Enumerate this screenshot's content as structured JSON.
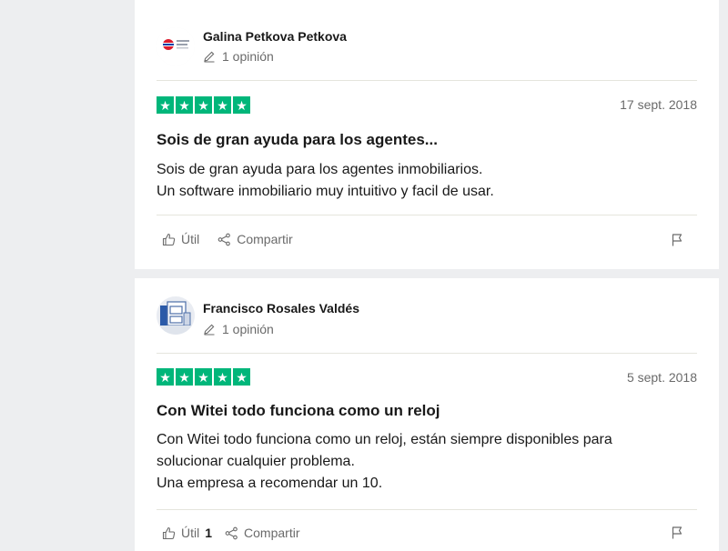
{
  "reviews": [
    {
      "author": "Galina Petkova Petkova",
      "reviews_count": "1 opinión",
      "rating": 5,
      "date": "17 sept. 2018",
      "title": "Sois de gran ayuda para los agentes...",
      "body": [
        "Sois de gran ayuda para los agentes inmobiliarios.",
        "Un software inmobiliario muy intuitivo y facil de usar."
      ],
      "useful_label": "Útil",
      "useful_count": "",
      "share_label": "Compartir"
    },
    {
      "author": "Francisco Rosales Valdés",
      "reviews_count": "1 opinión",
      "rating": 5,
      "date": "5 sept. 2018",
      "title": "Con Witei todo funciona como un reloj",
      "body": [
        "Con Witei todo funciona como un reloj, están siempre disponibles para",
        "solucionar cualquier problema.",
        "Una empresa a recomendar un 10."
      ],
      "useful_label": "Útil",
      "useful_count": "1",
      "share_label": "Compartir"
    }
  ],
  "colors": {
    "star_green": "#00b67a",
    "page_bg": "#edeef0"
  },
  "icons": [
    "pencil-icon",
    "star-icon",
    "thumbs-up-icon",
    "share-icon",
    "flag-icon"
  ]
}
